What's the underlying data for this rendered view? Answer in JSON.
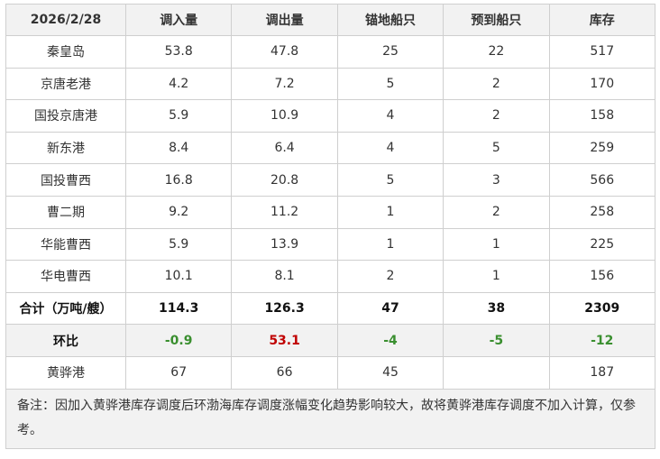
{
  "headers": [
    "2026/2/28",
    "调入量",
    "调出量",
    "锚地船只",
    "预到船只",
    "库存"
  ],
  "rows": [
    [
      "秦皇岛",
      "53.8",
      "47.8",
      "25",
      "22",
      "517"
    ],
    [
      "京唐老港",
      "4.2",
      "7.2",
      "5",
      "2",
      "170"
    ],
    [
      "国投京唐港",
      "5.9",
      "10.9",
      "4",
      "2",
      "158"
    ],
    [
      "新东港",
      "8.4",
      "6.4",
      "4",
      "5",
      "259"
    ],
    [
      "国投曹西",
      "16.8",
      "20.8",
      "5",
      "3",
      "566"
    ],
    [
      "曹二期",
      "9.2",
      "11.2",
      "1",
      "2",
      "258"
    ],
    [
      "华能曹西",
      "5.9",
      "13.9",
      "1",
      "1",
      "225"
    ],
    [
      "华电曹西",
      "10.1",
      "8.1",
      "2",
      "1",
      "156"
    ]
  ],
  "total": [
    "合计（万吨/艘）",
    "114.3",
    "126.3",
    "47",
    "38",
    "2309"
  ],
  "change": [
    "环比",
    "-0.9",
    "53.1",
    "-4",
    "-5",
    "-12"
  ],
  "huanghua": [
    "黄骅港",
    "67",
    "66",
    "45",
    "",
    "187"
  ],
  "note": "备注：因加入黄骅港库存调度后环渤海库存调度涨幅变化趋势影响较大，故将黄骅港库存调度不加入计算，仅参考。",
  "colors": {
    "positive": "#c00000",
    "negative": "#3a8f2f",
    "header_bg": "#f2f2f2"
  }
}
